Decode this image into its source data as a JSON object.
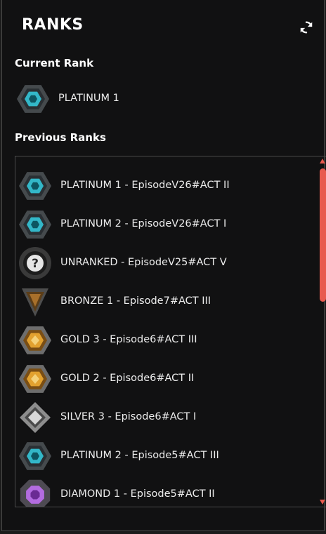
{
  "header": {
    "logo_text": "RANKS",
    "refresh_icon": "refresh-icon"
  },
  "current": {
    "title": "Current Rank",
    "rank": {
      "label": "PLATINUM 1",
      "tier": "platinum"
    }
  },
  "previous": {
    "title": "Previous Ranks",
    "items": [
      {
        "label": "PLATINUM 1 - EpisodeV26#ACT II",
        "tier": "platinum"
      },
      {
        "label": "PLATINUM 2 - EpisodeV26#ACT I",
        "tier": "platinum"
      },
      {
        "label": "UNRANKED - EpisodeV25#ACT V",
        "tier": "unranked"
      },
      {
        "label": "BRONZE 1 - Episode7#ACT III",
        "tier": "bronze"
      },
      {
        "label": "GOLD 3 - Episode6#ACT III",
        "tier": "gold"
      },
      {
        "label": "GOLD 2 - Episode6#ACT II",
        "tier": "gold"
      },
      {
        "label": "SILVER 3 - Episode6#ACT I",
        "tier": "silver"
      },
      {
        "label": "PLATINUM 2 - Episode5#ACT III",
        "tier": "platinum"
      },
      {
        "label": "DIAMOND 1 - Episode5#ACT II",
        "tier": "diamond"
      }
    ]
  },
  "colors": {
    "accent": "#e85a4f",
    "platinum": "#33b7c8",
    "gold": "#e2a12f",
    "bronze": "#a8702b",
    "silver": "#d7d7d7",
    "diamond": "#b36ce0",
    "unranked": "#8c8c8c"
  }
}
